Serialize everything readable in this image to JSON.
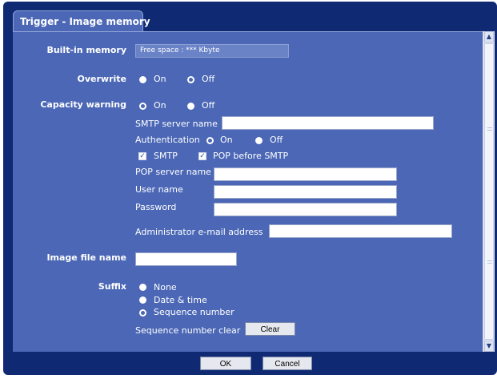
{
  "tab": {
    "title": "Trigger - Image memory"
  },
  "built_in_memory": {
    "label": "Built-in memory",
    "free_space": "Free space : *** Kbyte"
  },
  "overwrite": {
    "label": "Overwrite",
    "options": [
      "On",
      "Off"
    ],
    "selected": "Off"
  },
  "capacity_warning": {
    "label": "Capacity warning",
    "options": [
      "On",
      "Off"
    ],
    "selected": "On",
    "smtp_server_name": {
      "label": "SMTP server name",
      "value": ""
    },
    "authentication": {
      "label": "Authentication",
      "options": [
        "On",
        "Off"
      ],
      "selected": "On",
      "smtp": {
        "label": "SMTP",
        "checked": true
      },
      "pop_before_smtp": {
        "label": "POP before SMTP",
        "checked": true
      }
    },
    "pop_server_name": {
      "label": "POP server name",
      "value": ""
    },
    "user_name": {
      "label": "User name",
      "value": ""
    },
    "password": {
      "label": "Password",
      "value": ""
    },
    "admin_email": {
      "label": "Administrator e-mail address",
      "value": ""
    }
  },
  "image_file_name": {
    "label": "Image file name",
    "value": ""
  },
  "suffix": {
    "label": "Suffix",
    "options": [
      "None",
      "Date & time",
      "Sequence number"
    ],
    "selected": "Sequence number",
    "sequence_clear_label": "Sequence number clear",
    "clear_button": "Clear"
  },
  "footer": {
    "ok": "OK",
    "cancel": "Cancel"
  },
  "colors": {
    "frame": "#0f2a72",
    "panel": "#4b67b6",
    "readonly_field": "#6a83c7"
  }
}
